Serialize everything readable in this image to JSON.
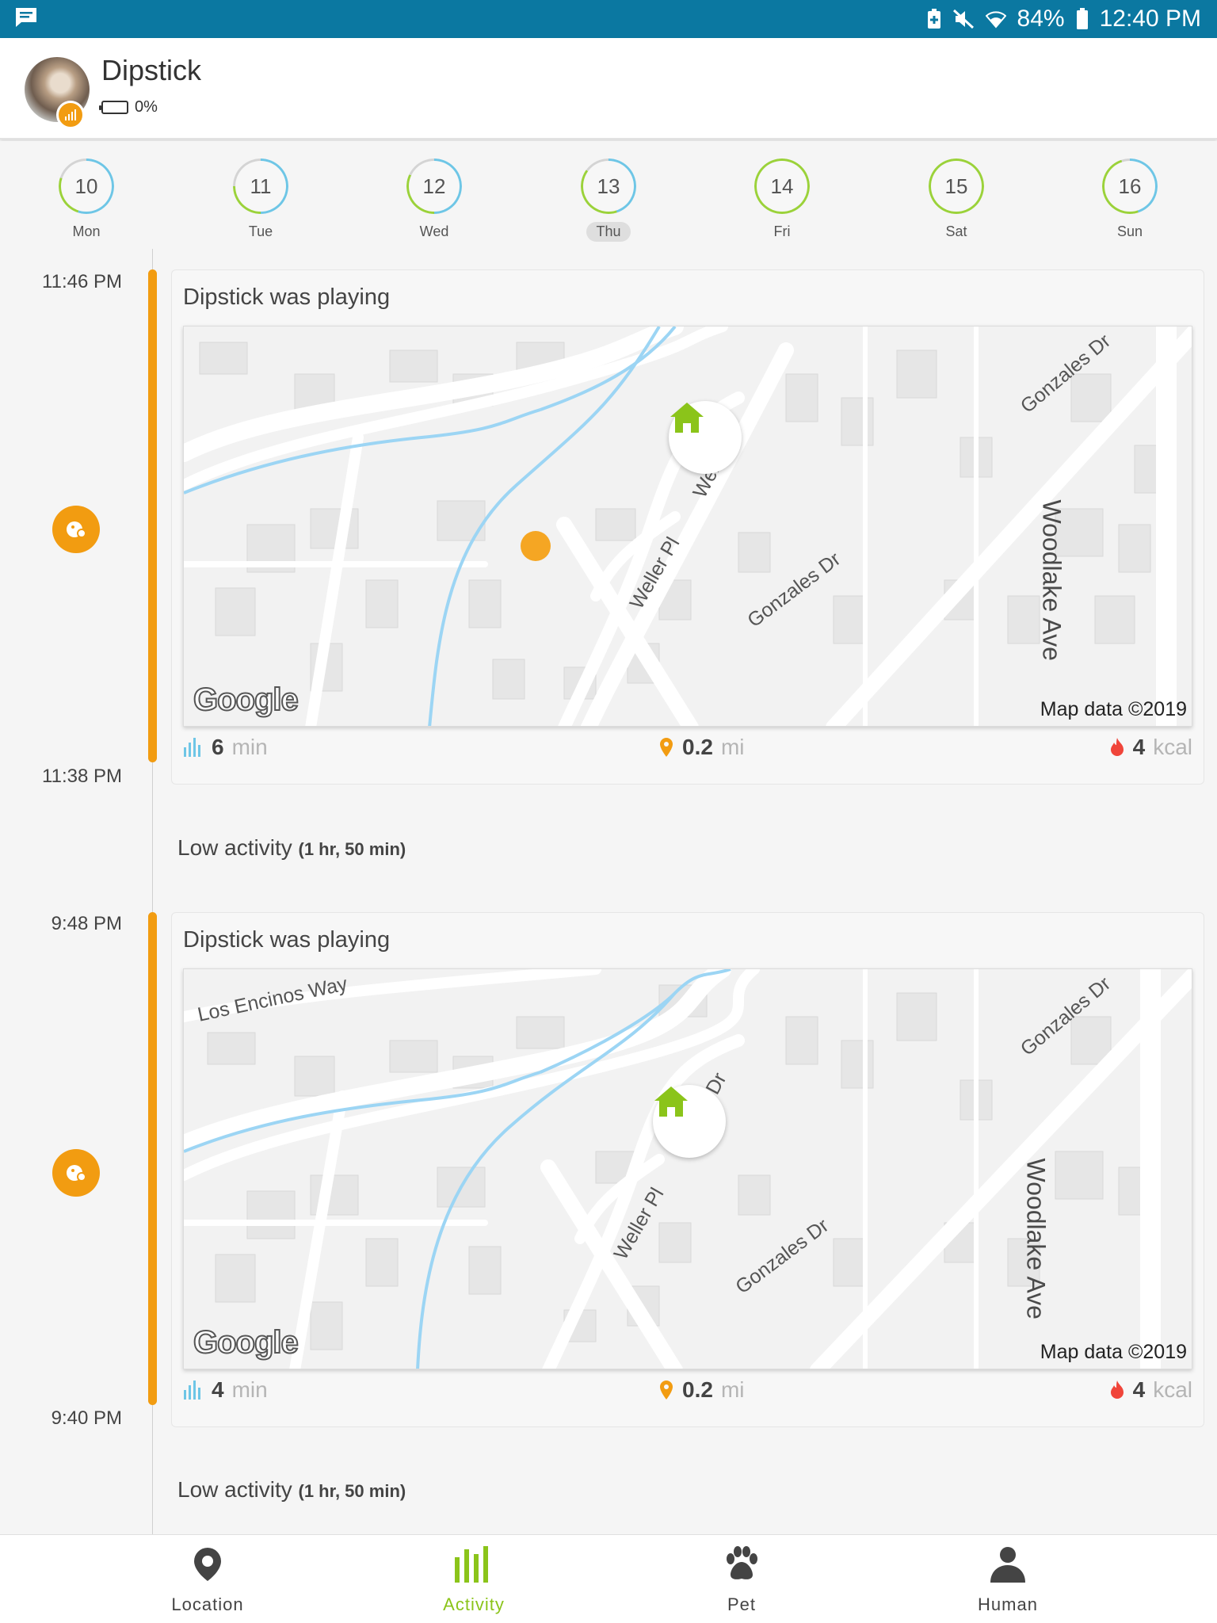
{
  "status_bar": {
    "battery_pct": "84%",
    "time": "12:40 PM",
    "icons": [
      "message-icon",
      "battery-saver-icon",
      "mute-icon",
      "wifi-icon",
      "battery-icon"
    ]
  },
  "header": {
    "pet_name": "Dipstick",
    "battery": "0%"
  },
  "days": [
    {
      "num": "10",
      "name": "Mon",
      "selected": false
    },
    {
      "num": "11",
      "name": "Tue",
      "selected": false
    },
    {
      "num": "12",
      "name": "Wed",
      "selected": false
    },
    {
      "num": "13",
      "name": "Thu",
      "selected": true
    },
    {
      "num": "14",
      "name": "Fri",
      "selected": false
    },
    {
      "num": "15",
      "name": "Sat",
      "selected": false
    },
    {
      "num": "16",
      "name": "Sun",
      "selected": false
    }
  ],
  "events": [
    {
      "start_time": "11:46 PM",
      "end_time": "11:38 PM",
      "title": "Dipstick was playing",
      "map": {
        "labels": [
          "Gonzales Dr",
          "Weller Dr",
          "Weller Pl",
          "Gonzales Dr",
          "Woodlake Ave"
        ],
        "logo": "Google",
        "attribution": "Map data ©2019"
      },
      "duration": {
        "value": "6",
        "unit": "min"
      },
      "distance": {
        "value": "0.2",
        "unit": "mi"
      },
      "calories": {
        "value": "4",
        "unit": "kcal"
      }
    },
    {
      "start_time": "9:48 PM",
      "end_time": "9:40 PM",
      "title": "Dipstick was playing",
      "map": {
        "labels": [
          "Los Encinos Way",
          "Gonzales Dr",
          "Weller Dr",
          "Weller Pl",
          "Gonzales Dr",
          "Woodlake Ave"
        ],
        "logo": "Google",
        "attribution": "Map data ©2019"
      },
      "duration": {
        "value": "4",
        "unit": "min"
      },
      "distance": {
        "value": "0.2",
        "unit": "mi"
      },
      "calories": {
        "value": "4",
        "unit": "kcal"
      }
    }
  ],
  "low_activity": [
    {
      "label": "Low activity",
      "duration": "(1 hr, 50 min)"
    },
    {
      "label": "Low activity",
      "duration": "(1 hr, 50 min)"
    }
  ],
  "nav": [
    {
      "label": "Location",
      "icon": "location-pin-icon",
      "active": false
    },
    {
      "label": "Activity",
      "icon": "activity-bars-icon",
      "active": true
    },
    {
      "label": "Pet",
      "icon": "paw-icon",
      "active": false
    },
    {
      "label": "Human",
      "icon": "person-icon",
      "active": false
    }
  ],
  "colors": {
    "status_bar": "#0b78a1",
    "accent_orange": "#f29c11",
    "accent_green": "#8bc41a",
    "ring_blue": "#6ec6e6"
  }
}
